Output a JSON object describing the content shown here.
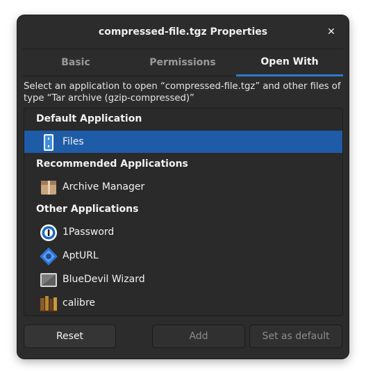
{
  "window": {
    "title": "compressed-file.tgz Properties",
    "close_glyph": "✕"
  },
  "tabs": [
    {
      "label": "Basic",
      "active": false
    },
    {
      "label": "Permissions",
      "active": false
    },
    {
      "label": "Open With",
      "active": true
    }
  ],
  "description": "Select an application to open “compressed-file.tgz” and other files of type “Tar archive (gzip-compressed)”",
  "sections": {
    "default": "Default Application",
    "recommended": "Recommended Applications",
    "other": "Other Applications"
  },
  "apps": {
    "default": [
      {
        "name": "Files",
        "icon": "files-icon",
        "selected": true
      }
    ],
    "recommended": [
      {
        "name": "Archive Manager",
        "icon": "archive-manager-icon"
      }
    ],
    "other": [
      {
        "name": "1Password",
        "icon": "1password-icon"
      },
      {
        "name": "AptURL",
        "icon": "apturl-icon"
      },
      {
        "name": "BlueDevil Wizard",
        "icon": "bluedevil-wizard-icon"
      },
      {
        "name": "calibre",
        "icon": "calibre-icon"
      }
    ]
  },
  "buttons": {
    "reset": "Reset",
    "add": "Add",
    "set_default": "Set as default"
  },
  "colors": {
    "accent": "#2f79c9",
    "selection": "#1f5ca8",
    "background": "#2c2c2c"
  }
}
